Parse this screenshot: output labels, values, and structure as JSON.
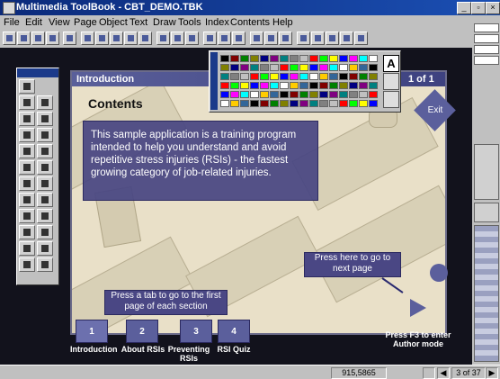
{
  "window": {
    "title": "Multimedia ToolBook - CBT_DEMO.TBK"
  },
  "menu": [
    "File",
    "Edit",
    "View",
    "Page",
    "Object",
    "Text",
    "Draw",
    "Tools",
    "Index",
    "Contents",
    "Help"
  ],
  "page": {
    "section_title": "Introduction",
    "page_indicator": "1 of 1",
    "heading": "Contents",
    "body": "This sample application is a training program intended to help you understand and avoid repetitive stress injuries (RSIs) - the fastest growing category of job-related injuries.",
    "exit_label": "Exit",
    "next_tip": "Press here to go to next page",
    "tab_tip": "Press a tab to go to the first page of each section",
    "tabs": [
      {
        "number": "1",
        "label": "Introduction"
      },
      {
        "number": "2",
        "label": "About RSIs"
      },
      {
        "number": "3",
        "label": "Preventing RSIs"
      },
      {
        "number": "4",
        "label": "RSI Quiz"
      }
    ],
    "author_hint": "Press F3 to enter Author mode"
  },
  "color_tray": {
    "text_tool_glyph": "A"
  },
  "status": {
    "coords": "915,5865",
    "page_count": "3 of 37"
  },
  "colors": {
    "accent": "#5b5f9c",
    "titlebar": "#0b2a7a",
    "page_bg": "#e9e0c8"
  }
}
